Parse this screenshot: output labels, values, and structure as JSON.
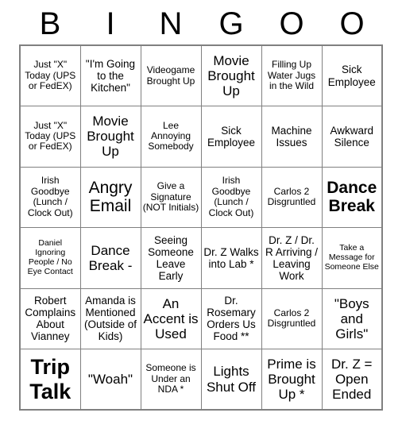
{
  "header": {
    "letters": [
      "B",
      "I",
      "N",
      "G",
      "O",
      "O"
    ]
  },
  "grid": {
    "columns": 6,
    "rows": 6,
    "cells": [
      [
        {
          "text": "Just \"X\" Today (UPS or FedEX)",
          "size": "fs-s",
          "bold": false
        },
        {
          "text": "\"I'm Going to the Kitchen\"",
          "size": "fs-m",
          "bold": false
        },
        {
          "text": "Videogame Brought Up",
          "size": "fs-s",
          "bold": false
        },
        {
          "text": "Movie Brought Up",
          "size": "fs-l",
          "bold": false
        },
        {
          "text": "Filling Up Water Jugs in the Wild",
          "size": "fs-s",
          "bold": false
        },
        {
          "text": "Sick Employee",
          "size": "fs-m",
          "bold": false
        }
      ],
      [
        {
          "text": "Just \"X\" Today (UPS or FedEX)",
          "size": "fs-s",
          "bold": false
        },
        {
          "text": "Movie Brought Up",
          "size": "fs-l",
          "bold": false
        },
        {
          "text": "Lee Annoying Somebody",
          "size": "fs-s",
          "bold": false
        },
        {
          "text": "Sick Employee",
          "size": "fs-m",
          "bold": false
        },
        {
          "text": "Machine Issues",
          "size": "fs-m",
          "bold": false
        },
        {
          "text": "Awkward Silence",
          "size": "fs-m",
          "bold": false
        }
      ],
      [
        {
          "text": "Irish Goodbye (Lunch / Clock Out)",
          "size": "fs-s",
          "bold": false
        },
        {
          "text": "Angry Email",
          "size": "fs-xl",
          "bold": false
        },
        {
          "text": "Give a Signature (NOT Initials)",
          "size": "fs-s",
          "bold": false
        },
        {
          "text": "Irish Goodbye (Lunch / Clock Out)",
          "size": "fs-s",
          "bold": false
        },
        {
          "text": "Carlos 2 Disgruntled",
          "size": "fs-s",
          "bold": false
        },
        {
          "text": "Dance Break",
          "size": "fs-xl",
          "bold": true
        }
      ],
      [
        {
          "text": "Daniel Ignoring People / No Eye Contact",
          "size": "fs-xs",
          "bold": false
        },
        {
          "text": "Dance Break -",
          "size": "fs-l",
          "bold": false
        },
        {
          "text": "Seeing Someone Leave Early",
          "size": "fs-m",
          "bold": false
        },
        {
          "text": "Dr. Z Walks into Lab *",
          "size": "fs-m",
          "bold": false
        },
        {
          "text": "Dr. Z / Dr. R Arriving / Leaving Work",
          "size": "fs-m",
          "bold": false
        },
        {
          "text": "Take a Message for Someone Else",
          "size": "fs-xs",
          "bold": false
        }
      ],
      [
        {
          "text": "Robert Complains About Vianney",
          "size": "fs-m",
          "bold": false
        },
        {
          "text": "Amanda is Mentioned (Outside of Kids)",
          "size": "fs-m",
          "bold": false
        },
        {
          "text": "An Accent is Used",
          "size": "fs-l",
          "bold": false
        },
        {
          "text": "Dr. Rosemary Orders Us Food **",
          "size": "fs-m",
          "bold": false
        },
        {
          "text": "Carlos 2 Disgruntled",
          "size": "fs-s",
          "bold": false
        },
        {
          "text": "\"Boys and Girls\"",
          "size": "fs-l",
          "bold": false
        }
      ],
      [
        {
          "text": "Trip Talk",
          "size": "fs-xxl",
          "bold": true
        },
        {
          "text": "\"Woah\"",
          "size": "fs-l",
          "bold": false
        },
        {
          "text": "Someone is Under an NDA *",
          "size": "fs-s",
          "bold": false
        },
        {
          "text": "Lights Shut Off",
          "size": "fs-l",
          "bold": false
        },
        {
          "text": "Prime is Brought Up *",
          "size": "fs-l",
          "bold": false
        },
        {
          "text": "Dr. Z = Open Ended",
          "size": "fs-l",
          "bold": false
        }
      ]
    ]
  },
  "colors": {
    "background": "#ffffff",
    "text": "#000000",
    "grid_line": "#808080"
  }
}
